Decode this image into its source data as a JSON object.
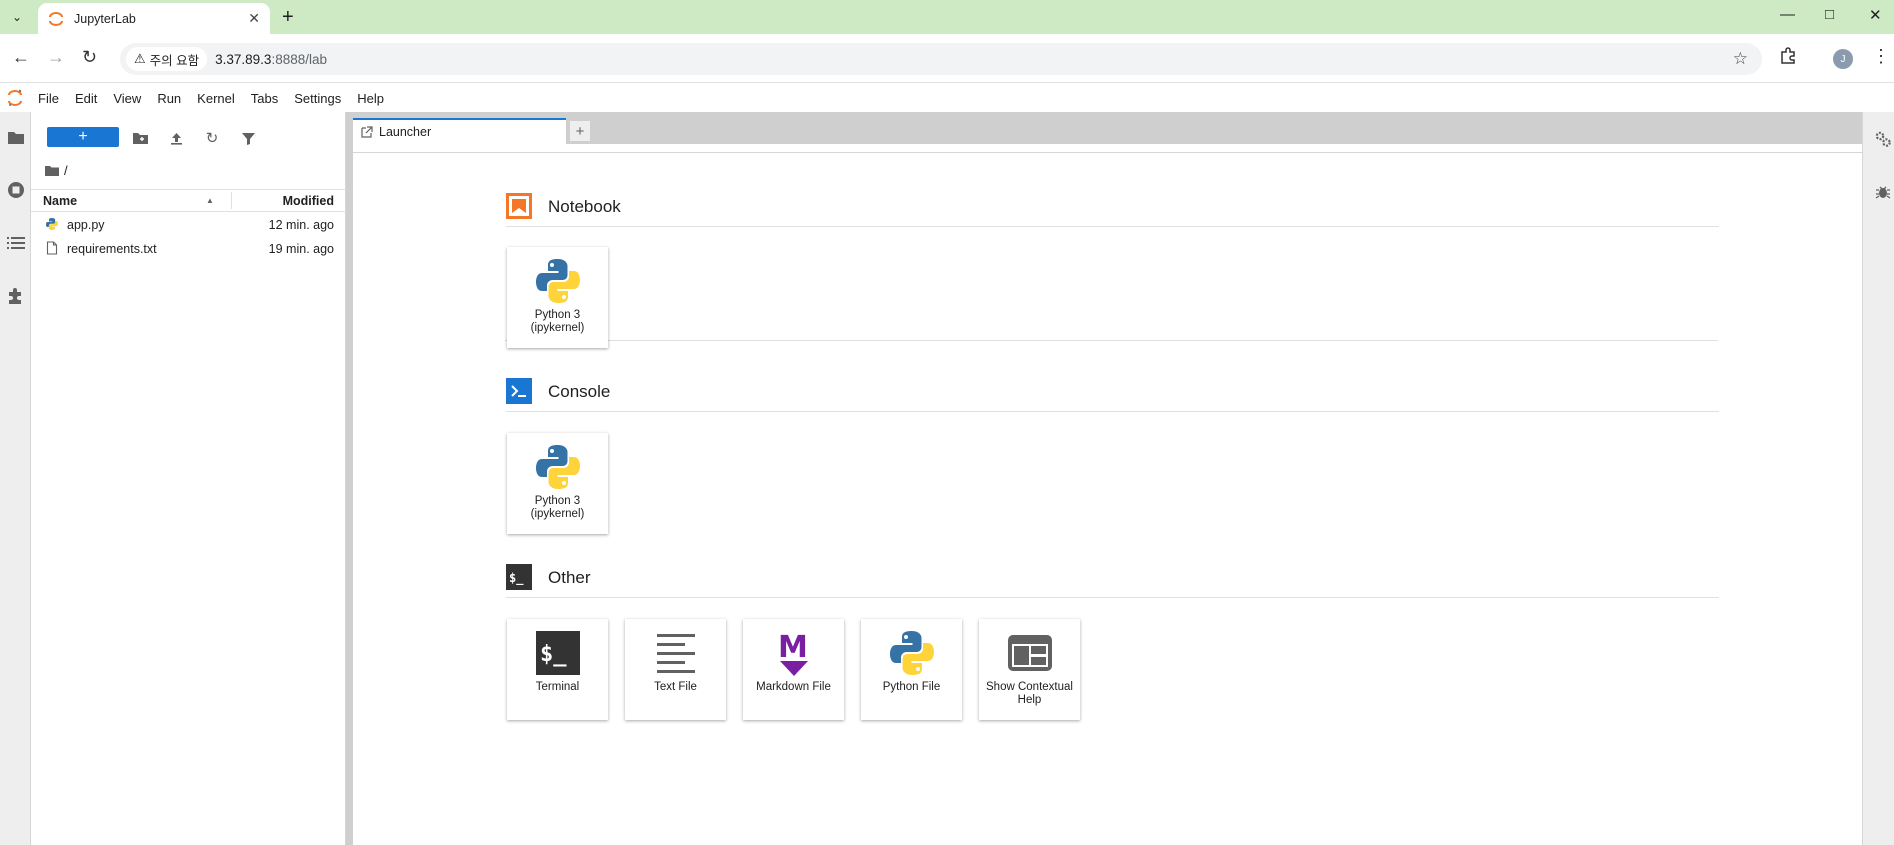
{
  "browser": {
    "tab_title": "JupyterLab",
    "security_label": "주의 요함",
    "url_host": "3.37.89.3",
    "url_rest": ":8888/lab",
    "profile_initial": "J"
  },
  "menubar": {
    "items": [
      "File",
      "Edit",
      "View",
      "Run",
      "Kernel",
      "Tabs",
      "Settings",
      "Help"
    ]
  },
  "filebrowser": {
    "new_button_label": "+",
    "breadcrumb": "/",
    "columns": {
      "name": "Name",
      "modified": "Modified"
    },
    "files": [
      {
        "name": "app.py",
        "modified": "12 min. ago",
        "icon": "python-file-icon"
      },
      {
        "name": "requirements.txt",
        "modified": "19 min. ago",
        "icon": "text-file-icon"
      }
    ]
  },
  "dock": {
    "tab_label": "Launcher",
    "add_tab_label": "+"
  },
  "launcher": {
    "sections": [
      {
        "title": "Notebook",
        "icon": "notebook-icon",
        "color": "#f37726",
        "cards": [
          {
            "label": "Python 3 (ipykernel)",
            "icon": "python-logo-icon"
          }
        ]
      },
      {
        "title": "Console",
        "icon": "console-icon",
        "color": "#1976d2",
        "cards": [
          {
            "label": "Python 3 (ipykernel)",
            "icon": "python-logo-icon"
          }
        ]
      },
      {
        "title": "Other",
        "icon": "terminal-section-icon",
        "color": "#333333",
        "cards": [
          {
            "label": "Terminal",
            "icon": "terminal-icon"
          },
          {
            "label": "Text File",
            "icon": "text-lines-icon"
          },
          {
            "label": "Markdown File",
            "icon": "markdown-icon"
          },
          {
            "label": "Python File",
            "icon": "python-logo-icon"
          },
          {
            "label": "Show Contextual Help",
            "icon": "contextual-help-icon"
          }
        ]
      }
    ]
  },
  "colors": {
    "accent": "#1976d2",
    "jupyter_orange": "#f37726",
    "markdown_purple": "#7b1fa2",
    "tabstrip_green": "#cdeac4"
  }
}
